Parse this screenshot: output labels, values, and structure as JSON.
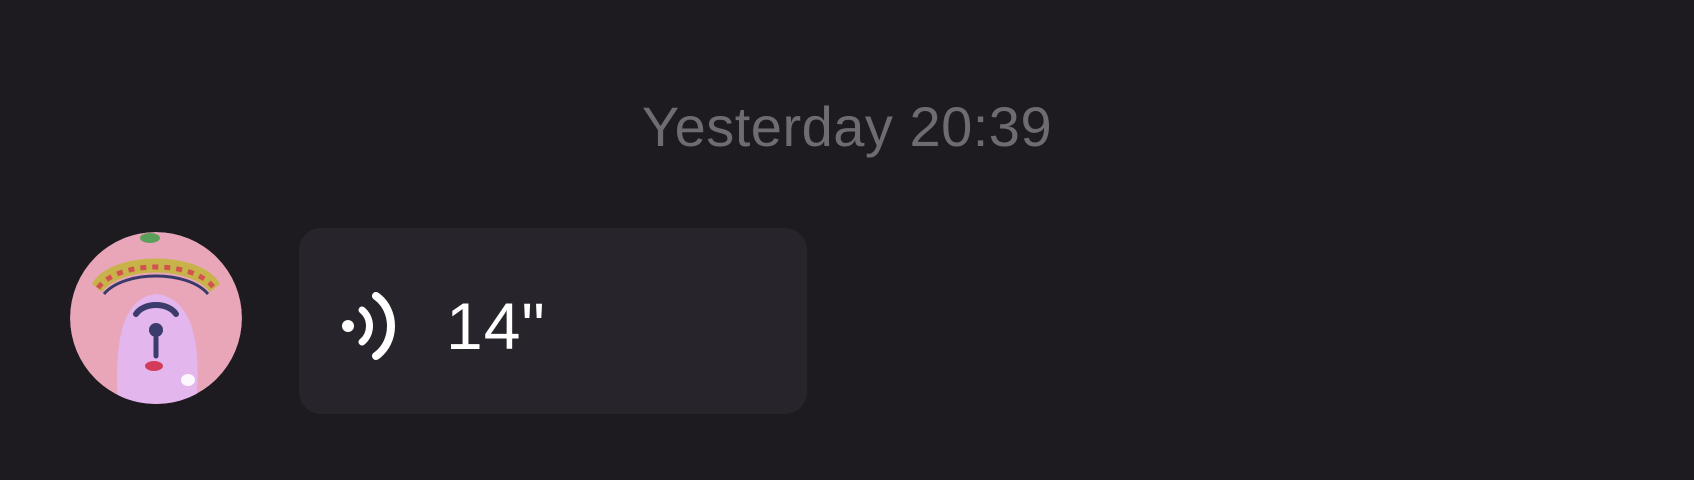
{
  "chat": {
    "timestamp": "Yesterday 20:39",
    "messages": [
      {
        "type": "voice",
        "sender": "incoming",
        "avatar_icon": "avatar-icon",
        "playback_icon": "voice-wave-icon",
        "duration": "14\""
      }
    ]
  },
  "colors": {
    "background": "#1d1b20",
    "bubble": "#27252b",
    "timestamp_text": "#6e6c71",
    "message_text": "#ffffff"
  }
}
